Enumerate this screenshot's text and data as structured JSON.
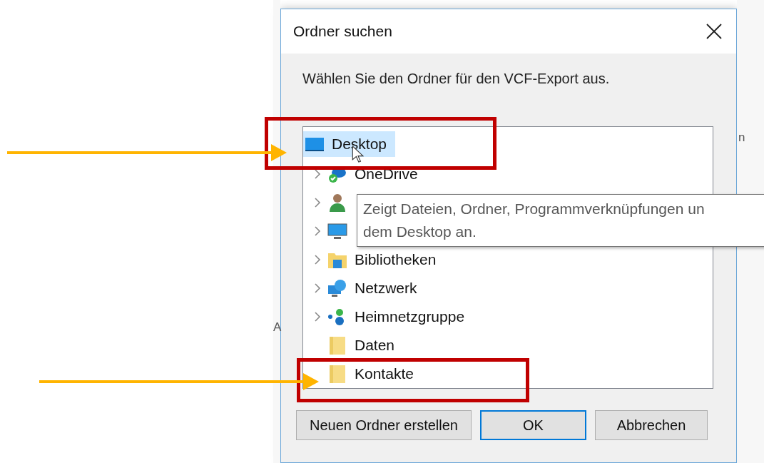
{
  "dialog": {
    "title": "Ordner suchen",
    "message": "Wählen Sie den Ordner für den VCF-Export aus.",
    "tree": {
      "label": "Desktop",
      "kind": "desktop",
      "selected": true,
      "children": [
        {
          "label": "OneDrive",
          "kind": "onedrive",
          "expandable": true,
          "selected": false
        },
        {
          "kind": "user",
          "expandable": true,
          "selected": false
        },
        {
          "kind": "computer",
          "expandable": true,
          "selected": false
        },
        {
          "label": "Bibliotheken",
          "kind": "libraries",
          "expandable": true,
          "selected": false
        },
        {
          "label": "Netzwerk",
          "kind": "network",
          "expandable": true,
          "selected": false
        },
        {
          "label": "Heimnetzgruppe",
          "kind": "homegroup",
          "expandable": true,
          "selected": false
        },
        {
          "label": "Daten",
          "kind": "folder",
          "expandable": false,
          "selected": false
        },
        {
          "label": "Kontakte",
          "kind": "folder",
          "expandable": false,
          "selected": false
        }
      ]
    },
    "tooltip": [
      "Zeigt Dateien, Ordner, Programmverknüpfungen un",
      "dem Desktop an."
    ],
    "buttons": [
      {
        "label": "Neuen Ordner erstellen",
        "default": false
      },
      {
        "label": "OK",
        "default": true
      },
      {
        "label": "Abbrechen",
        "default": false
      }
    ]
  },
  "background_texts": [
    "n",
    "A"
  ]
}
